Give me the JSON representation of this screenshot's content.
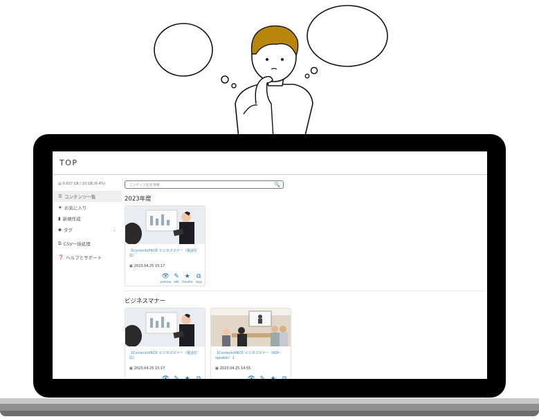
{
  "app": {
    "title": "TOP"
  },
  "sidebar": {
    "storage": "0.637 GB / 10 GB (6.4%)",
    "items": [
      {
        "label": "コンテンツ一覧",
        "icon": "list-icon"
      },
      {
        "label": "お気に入り",
        "icon": "star-icon"
      },
      {
        "label": "新規作成",
        "icon": "file-icon"
      },
      {
        "label": "タグ",
        "icon": "tag-icon"
      },
      {
        "label": "CSV一括処理",
        "icon": "csv-icon"
      },
      {
        "label": "ヘルプとサポート",
        "icon": "help-icon"
      }
    ]
  },
  "search": {
    "placeholder": "コンテンツ名を検索"
  },
  "groups": [
    {
      "title": "2023年度",
      "cards": [
        {
          "title": "【ContentsPRO】ビジネスマナー（電話対応）",
          "date": "2023.04.25 15:17"
        }
      ]
    },
    {
      "title": "ビジネスマナー",
      "cards": [
        {
          "title": "【ContentsPRO】ビジネスマナー（電話対応）",
          "date": "2023.04.25 15:17"
        },
        {
          "title": "【ContentsPRO】ビジネスマナー（RSP-speaker）1",
          "date": "2023.04.25 14:55"
        }
      ]
    }
  ],
  "actions": {
    "preview": "preview",
    "edit": "edit",
    "favorite": "favorite",
    "copy": "copy"
  },
  "colors": {
    "accent": "#1f77b4",
    "link": "#3a8cc6",
    "bezel": "#000000"
  }
}
